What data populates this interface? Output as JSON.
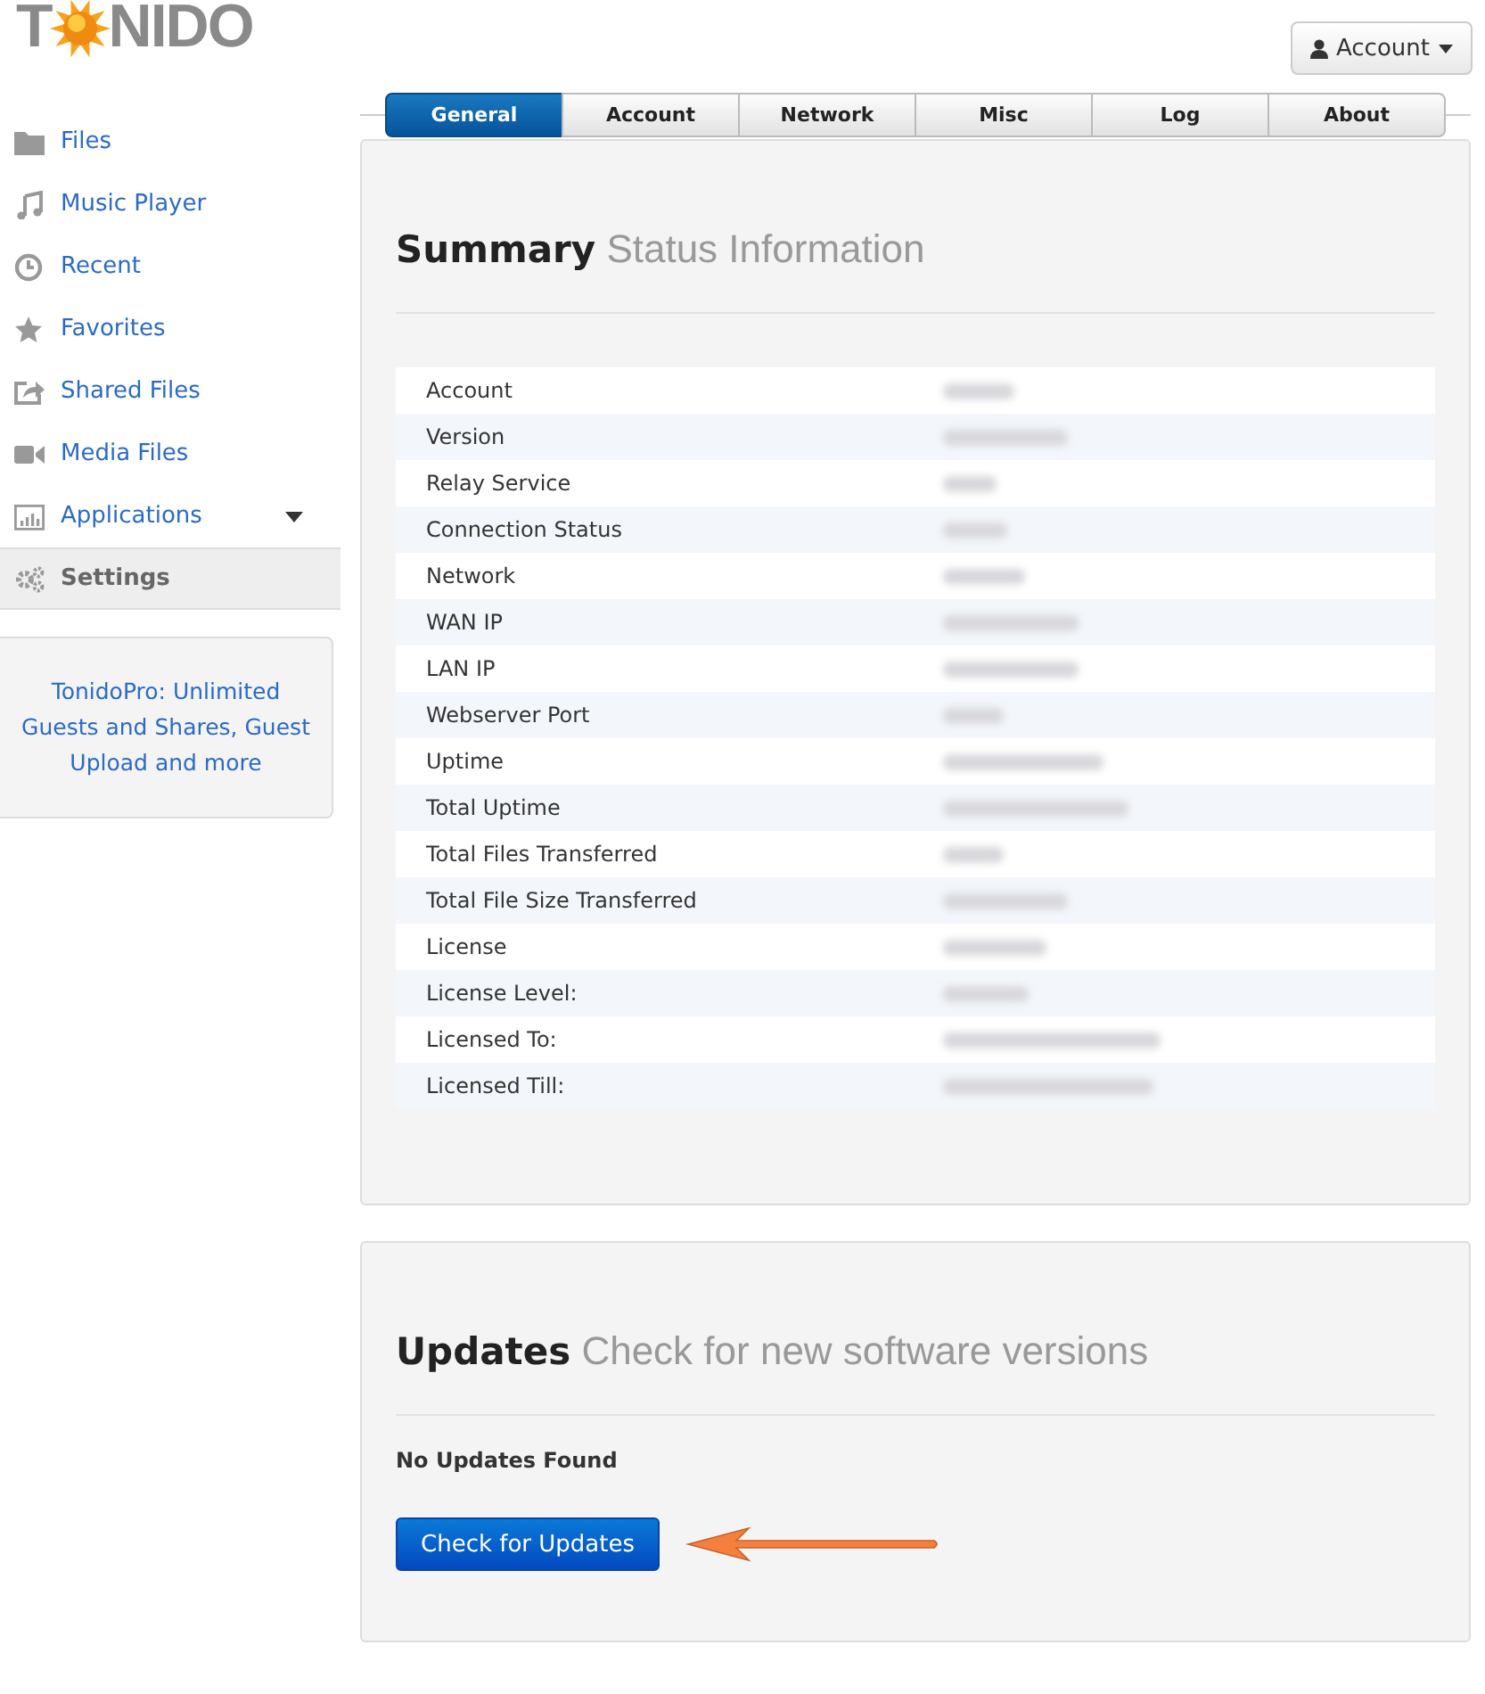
{
  "logo": {
    "lead": "T",
    "rest": "NIDO"
  },
  "account_button": {
    "label": "Account"
  },
  "sidebar": {
    "items": [
      {
        "label": "Files",
        "selected": false
      },
      {
        "label": "Music Player",
        "selected": false
      },
      {
        "label": "Recent",
        "selected": false
      },
      {
        "label": "Favorites",
        "selected": false
      },
      {
        "label": "Shared Files",
        "selected": false
      },
      {
        "label": "Media Files",
        "selected": false
      },
      {
        "label": "Applications",
        "selected": false,
        "has_dropdown": true
      },
      {
        "label": "Settings",
        "selected": true
      }
    ],
    "promo": "TonidoPro: Unlimited Guests and Shares, Guest Upload and more"
  },
  "tabs": [
    {
      "label": "General",
      "selected": true
    },
    {
      "label": "Account",
      "selected": false
    },
    {
      "label": "Network",
      "selected": false
    },
    {
      "label": "Misc",
      "selected": false
    },
    {
      "label": "Log",
      "selected": false
    },
    {
      "label": "About",
      "selected": false
    }
  ],
  "summary": {
    "title": "Summary",
    "subtitle": "Status Information",
    "rows": [
      {
        "label": "Account"
      },
      {
        "label": "Version"
      },
      {
        "label": "Relay Service"
      },
      {
        "label": "Connection Status"
      },
      {
        "label": "Network"
      },
      {
        "label": "WAN IP"
      },
      {
        "label": "LAN IP"
      },
      {
        "label": "Webserver Port"
      },
      {
        "label": "Uptime"
      },
      {
        "label": "Total Uptime"
      },
      {
        "label": "Total Files Transferred"
      },
      {
        "label": "Total File Size Transferred"
      },
      {
        "label": "License"
      },
      {
        "label": "License Level:"
      },
      {
        "label": "Licensed To:"
      },
      {
        "label": "Licensed Till:"
      }
    ]
  },
  "updates": {
    "title": "Updates",
    "subtitle": "Check for new software versions",
    "status": "No Updates Found",
    "button": "Check for Updates"
  }
}
